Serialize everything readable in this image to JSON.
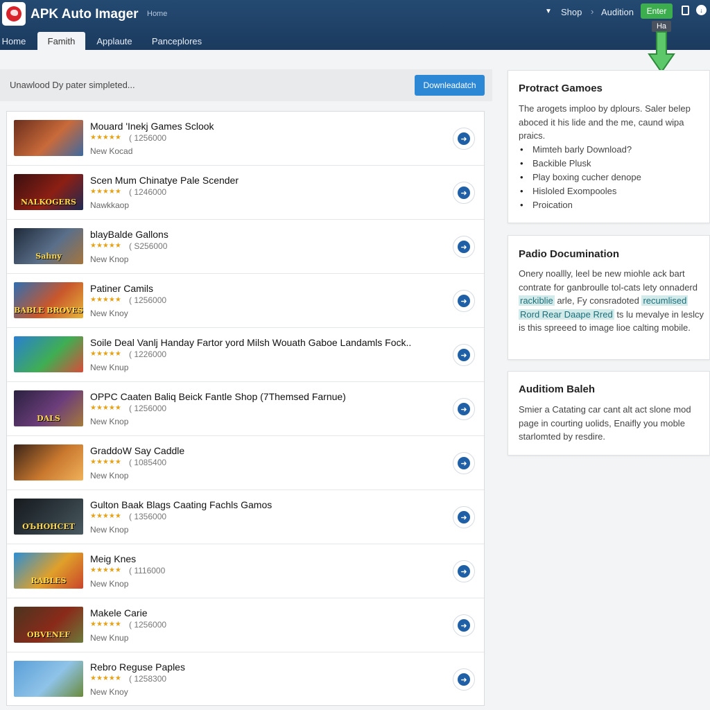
{
  "header": {
    "app_title": "APK Auto Imager",
    "subtitle": "Home",
    "shop_label": "Shop",
    "audition_label": "Audition",
    "enter_label": "Enter",
    "tooltip": "Ha",
    "caret": "▼",
    "separator": "›"
  },
  "tabs": [
    {
      "label": "Home"
    },
    {
      "label": "Famith"
    },
    {
      "label": "Applaute"
    },
    {
      "label": "Panceplores"
    }
  ],
  "search": {
    "text": "Unawlood Dy pater simpleted...",
    "download_label": "Downleadatch"
  },
  "games": [
    {
      "title": "Mouard 'Inekj Games Sclook",
      "stars": "★★★★★",
      "count": "( 1256000",
      "sub": "New Kocad",
      "thumb_label": "",
      "colors": [
        "#6b2e1d",
        "#c96a3a",
        "#3c6aa0"
      ]
    },
    {
      "title": "Scen Mum Chinatye Pale Scender",
      "stars": "★★★★★",
      "count": "( 1246000",
      "sub": "Nawkkaop",
      "thumb_label": "NALKOGERS",
      "colors": [
        "#3a1010",
        "#8c1f14",
        "#1e2a52"
      ]
    },
    {
      "title": "blayBalde Gallons",
      "stars": "★★★★★",
      "count": "( S256000",
      "sub": "New Knop",
      "thumb_label": "Sahny",
      "colors": [
        "#1f2a3a",
        "#5a6f8a",
        "#a5753c"
      ]
    },
    {
      "title": "Patiner Camils",
      "stars": "★★★★★",
      "count": "( 1256000",
      "sub": "New Knoy",
      "thumb_label": "BABLE BROVES",
      "colors": [
        "#2e6fb2",
        "#c9572b",
        "#e6b43a"
      ]
    },
    {
      "title": "Soile Deal Vanlj Handay Fartor yord Milsh Wouath Gaboe Landamls Fock..",
      "stars": "★★★★★",
      "count": "( 1226000",
      "sub": "New Knup",
      "thumb_label": "",
      "colors": [
        "#2a7fd0",
        "#3fae53",
        "#d94c3a"
      ]
    },
    {
      "title": "OPPC Caaten Baliq Beick Fantle Shop (7Themsed Farnue)",
      "stars": "★★★★★",
      "count": "( 1256000",
      "sub": "New Knop",
      "thumb_label": "DALS",
      "colors": [
        "#2a2140",
        "#6b3d7a",
        "#a57a3a"
      ]
    },
    {
      "title": "GraddoW Say Caddle",
      "stars": "★★★★★",
      "count": "( 1085400",
      "sub": "New Knop",
      "thumb_label": "",
      "colors": [
        "#3a2418",
        "#c9782e",
        "#f0b15a"
      ]
    },
    {
      "title": "Gulton Baak Blags Caating Fachls Gamos",
      "stars": "★★★★★",
      "count": "( 1356000",
      "sub": "New Knop",
      "thumb_label": "ОЪНОНСЕТ",
      "colors": [
        "#161a1e",
        "#2f3a40",
        "#4a5a60"
      ]
    },
    {
      "title": "Meig Knes",
      "stars": "★★★★★",
      "count": "( 1116000",
      "sub": "New Knop",
      "thumb_label": "RABLES",
      "colors": [
        "#2a8fd6",
        "#e0a02a",
        "#c9442b"
      ]
    },
    {
      "title": "Makele Carie",
      "stars": "★★★★★",
      "count": "( 1256000",
      "sub": "New Knup",
      "thumb_label": "OBVENEF",
      "colors": [
        "#4a3520",
        "#8a2a1a",
        "#6b7a3a"
      ]
    },
    {
      "title": "Rebro Reguse Paples",
      "stars": "★★★★★",
      "count": "( 1258300",
      "sub": "New Knoy",
      "thumb_label": "",
      "colors": [
        "#5a9fd8",
        "#8fc3e8",
        "#6a8a3a"
      ]
    }
  ],
  "cards": {
    "product": {
      "title": "Protract Gamoes",
      "text": "The arogets imploo by dplours. Saler belep aboced it his lide and the me, caund wipa praics.",
      "bullets": [
        "Mimteh barly Download?",
        "Backible Plusk",
        "Play boxing cucher denope",
        "Hisloled Exompooles",
        "Proication"
      ]
    },
    "doc": {
      "title": "Padio Documination",
      "line1": "Onery noallly, leel be new miohle ack bart contrate for ganbroulle tol-cats lety onnaderd",
      "hl1": "rackiblie",
      "mid1": "arle, Fy consradoted",
      "hl2": "recumlised",
      "hl3": "Rord Rear Daape Rred",
      "mid2": "ts lu mevalye in leslcy is this spreeed to image lioe calting mobile."
    },
    "audition": {
      "title": "Auditiom Baleh",
      "text": "Smier a Catating car cant alt act slone mod page in courting uolids, Enaifly you moble starlomted by resdire."
    }
  },
  "colors": {
    "header": "#1b3a5e",
    "accent": "#2c87d4",
    "enter": "#3cae4e",
    "stars": "#e3a21a"
  }
}
